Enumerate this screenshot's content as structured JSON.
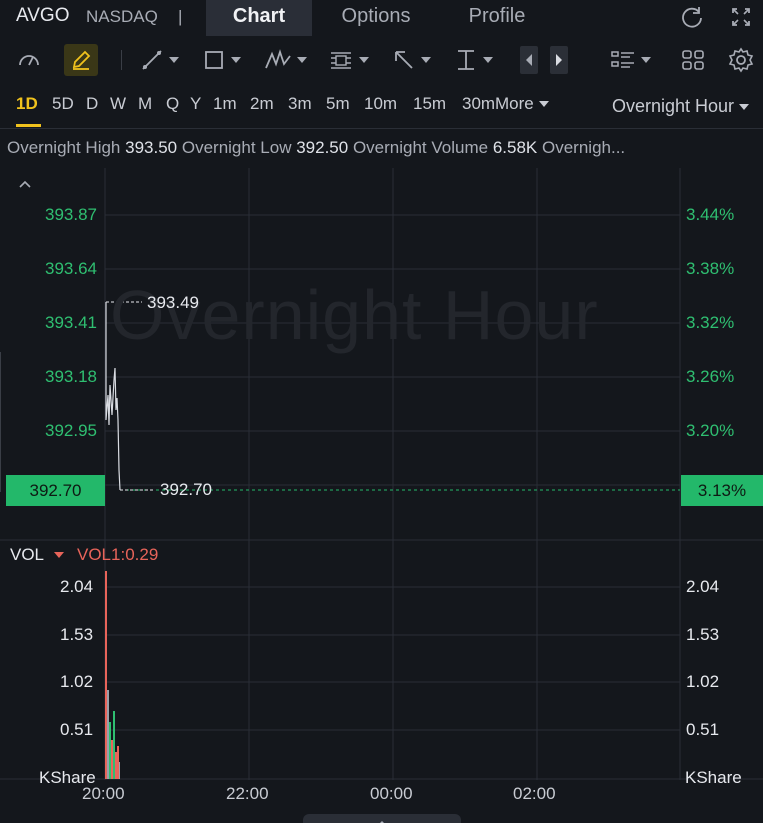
{
  "header": {
    "ticker": "AVGO",
    "exchange": "NASDAQ",
    "separator": "|",
    "tabs": [
      "Chart",
      "Options",
      "Profile"
    ],
    "active_tab": "Chart",
    "icons": [
      "refresh-icon",
      "fullscreen-icon"
    ]
  },
  "toolbar": {
    "tools": [
      "draw-mode-icon",
      "pencil-icon",
      "trend-line-icon",
      "rectangle-icon",
      "pattern-icon",
      "fibonacci-icon",
      "arrow-icon",
      "measure-icon",
      "prev-icon",
      "next-icon",
      "list-icon",
      "layout-grid-icon",
      "settings-icon"
    ]
  },
  "periods": {
    "items": [
      "1D",
      "5D",
      "D",
      "W",
      "M",
      "Q",
      "Y",
      "1m",
      "2m",
      "3m",
      "5m",
      "10m",
      "15m",
      "30m",
      "More"
    ],
    "active": "1D",
    "session": "Overnight Hour"
  },
  "info": {
    "high_label": "Overnight High",
    "high_value": "393.50",
    "low_label": "Overnight Low",
    "low_value": "392.50",
    "volume_label": "Overnight Volume",
    "volume_value": "6.58K",
    "trailing": "Overnigh..."
  },
  "chart": {
    "watermark": "Overnight Hour",
    "price_ticks": [
      "393.87",
      "393.64",
      "393.41",
      "393.18",
      "392.95"
    ],
    "pct_ticks": [
      "3.44%",
      "3.38%",
      "3.32%",
      "3.26%",
      "3.20%"
    ],
    "current_price": "392.70",
    "current_pct": "3.13%",
    "high_marker": "393.49",
    "last_marker": "392.70",
    "accent_color": "#23b86a"
  },
  "volume": {
    "label": "VOL",
    "indicator": "VOL1:0.29",
    "ticks_left": [
      "2.04",
      "1.53",
      "1.02",
      "0.51"
    ],
    "ticks_right": [
      "2.04",
      "1.53",
      "1.02",
      "0.51"
    ],
    "unit": "KShare"
  },
  "time_axis": [
    "20:00",
    "22:00",
    "00:00",
    "02:00"
  ]
}
